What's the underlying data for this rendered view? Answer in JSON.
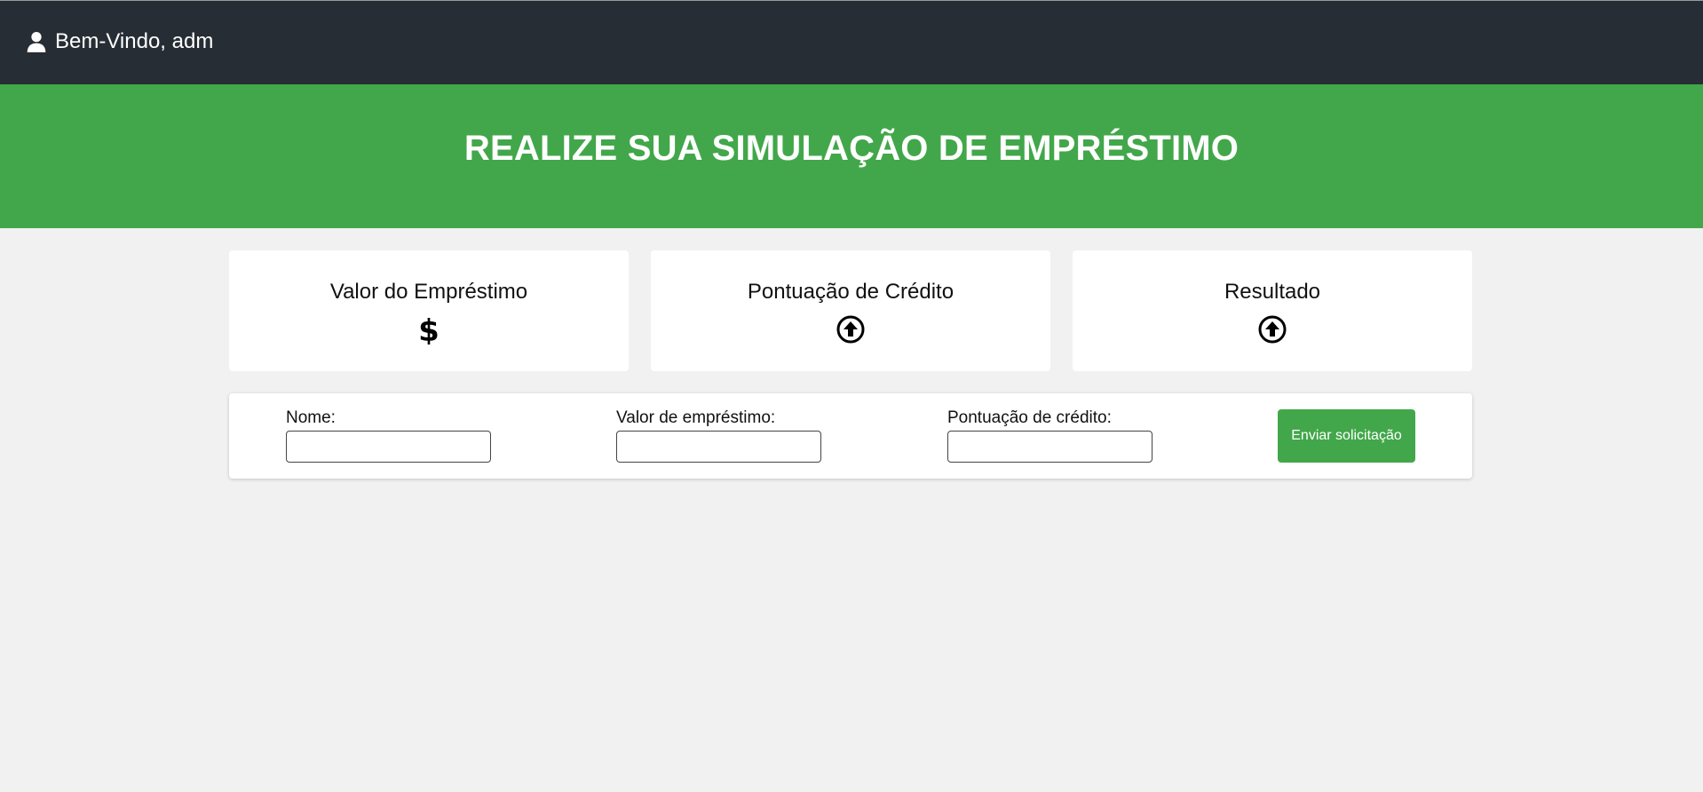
{
  "header": {
    "welcome_text": "Bem-Vindo, adm",
    "user_icon": "user-icon"
  },
  "hero": {
    "title": "REALIZE SUA SIMULAÇÃO DE EMPRÉSTIMO"
  },
  "cards": [
    {
      "title": "Valor do Empréstimo",
      "icon": "dollar-icon"
    },
    {
      "title": "Pontuação de Crédito",
      "icon": "arrow-circle-up-icon"
    },
    {
      "title": "Resultado",
      "icon": "arrow-circle-up-icon"
    }
  ],
  "form": {
    "fields": [
      {
        "label": "Nome:",
        "value": ""
      },
      {
        "label": "Valor de empréstimo:",
        "value": ""
      },
      {
        "label": "Pontuação de crédito:",
        "value": ""
      }
    ],
    "submit_label": "Enviar solicitação"
  },
  "colors": {
    "topbar": "#262d34",
    "accent_green": "#42a74a",
    "background": "#f1f1f1"
  }
}
